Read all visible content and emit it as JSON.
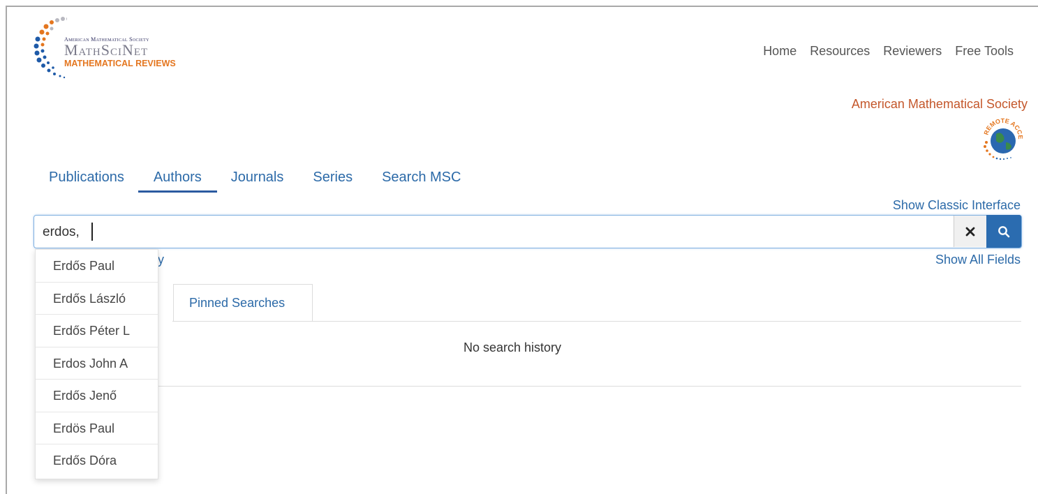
{
  "logo": {
    "line1": "American Mathematical Society",
    "line2": "MathSciNet",
    "line3": "MATHEMATICAL REVIEWS"
  },
  "topnav": [
    "Home",
    "Resources",
    "Reviewers",
    "Free Tools"
  ],
  "ams_link": "American Mathematical Society",
  "remote_badge": "REMOTE ACCESS",
  "tabs": [
    "Publications",
    "Authors",
    "Journals",
    "Series",
    "Search MSC"
  ],
  "active_tab": "Authors",
  "show_classic": "Show Classic Interface",
  "search": {
    "value": "erdos, "
  },
  "show_all_fields": "Show All Fields",
  "partial_text": "y",
  "pinned_searches": "Pinned Searches",
  "no_history": "No search history",
  "suggestions": [
    "Erdős Paul",
    "Erdős László",
    "Erdős Péter L",
    "Erdos John A",
    "Erdős Jenő",
    "Erdös Paul",
    "Erdős Dóra"
  ],
  "colors": {
    "link": "#2c6aa8",
    "accent": "#2b6cb0",
    "orange": "#e4761f"
  },
  "icons": [
    "close-icon",
    "search-icon",
    "globe-icon"
  ]
}
